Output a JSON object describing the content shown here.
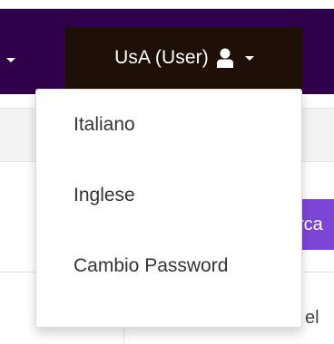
{
  "navbar": {
    "background_color": "#31004a",
    "user_menu": {
      "label": "UsA (User)",
      "icon": "user-icon",
      "caret_icon": "caret-down-icon",
      "background_color": "#1f1007"
    }
  },
  "dropdown": {
    "items": [
      {
        "label": "Italiano"
      },
      {
        "label": "Inglese"
      },
      {
        "label": "Cambio Password"
      }
    ]
  },
  "background": {
    "search_button_label_partial": "rca",
    "search_button_color": "#7b45d6",
    "cell_text_partial": "el"
  }
}
